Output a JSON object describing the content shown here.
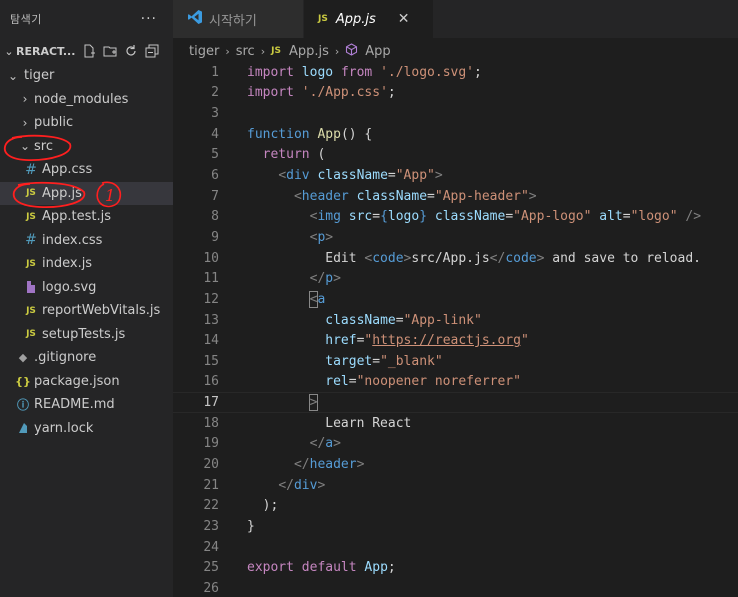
{
  "sidebar": {
    "title": "탐색기",
    "more": "···",
    "section": "RERACT...",
    "root": "tiger",
    "items": [
      {
        "label": "node_modules",
        "type": "folder",
        "depth": 1
      },
      {
        "label": "public",
        "type": "folder",
        "depth": 1
      },
      {
        "label": "src",
        "type": "folder-open",
        "depth": 1
      },
      {
        "label": "App.css",
        "type": "css",
        "depth": 2
      },
      {
        "label": "App.js",
        "type": "js",
        "depth": 2
      },
      {
        "label": "App.test.js",
        "type": "js",
        "depth": 2
      },
      {
        "label": "index.css",
        "type": "css",
        "depth": 2
      },
      {
        "label": "index.js",
        "type": "js",
        "depth": 2
      },
      {
        "label": "logo.svg",
        "type": "svg",
        "depth": 2
      },
      {
        "label": "reportWebVitals.js",
        "type": "js",
        "depth": 2
      },
      {
        "label": "setupTests.js",
        "type": "js",
        "depth": 2
      },
      {
        "label": ".gitignore",
        "type": "git",
        "depth": 1
      },
      {
        "label": "package.json",
        "type": "json",
        "depth": 1
      },
      {
        "label": "README.md",
        "type": "info",
        "depth": 1
      },
      {
        "label": "yarn.lock",
        "type": "yarn",
        "depth": 1
      }
    ],
    "annotation_number": "1"
  },
  "tabs": [
    {
      "label": "시작하기",
      "icon": "vscode-icon",
      "active": false
    },
    {
      "label": "App.js",
      "icon": "js-icon",
      "active": true,
      "close": "✕"
    }
  ],
  "breadcrumb": {
    "root": "tiger",
    "folder": "src",
    "file": "App.js",
    "symbol": "App"
  },
  "editor": {
    "current_line": 17,
    "lines": [
      "1",
      "2",
      "3",
      "4",
      "5",
      "6",
      "7",
      "8",
      "9",
      "10",
      "11",
      "12",
      "13",
      "14",
      "15",
      "16",
      "17",
      "18",
      "19",
      "20",
      "21",
      "22",
      "23",
      "24",
      "25",
      "26"
    ]
  },
  "colors": {
    "keyword": "#569cd6",
    "control": "#c586c0",
    "string": "#ce9178",
    "function": "#dcdcaa",
    "attribute": "#9cdcfe",
    "annotation": "#ff1f1f"
  }
}
